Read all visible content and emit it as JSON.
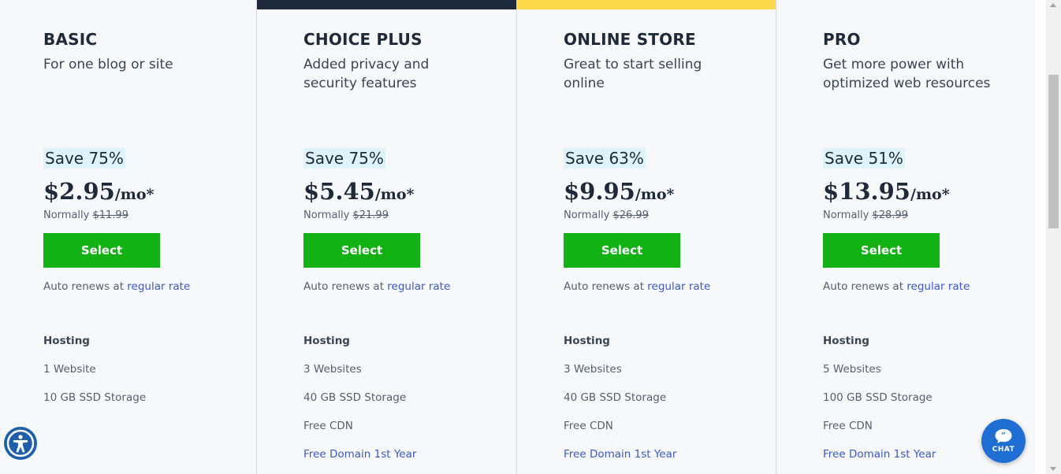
{
  "colors": {
    "choice_plus_topbar": "#1e2a3b",
    "online_store_topbar": "#fcd94a",
    "select_button": "#12b114",
    "link": "#3a59c7",
    "save_badge_bg": "#def3fa"
  },
  "plans": [
    {
      "name": "BASIC",
      "description": "For one blog or site",
      "save": "Save 75%",
      "price": "$2.95",
      "per": "/mo*",
      "normally_label": "Normally",
      "normal_price": "$11.99",
      "select_label": "Select",
      "renew_text": "Auto renews at",
      "renew_link": "regular rate",
      "features_heading": "Hosting",
      "features": [
        "1 Website",
        "10 GB SSD Storage"
      ]
    },
    {
      "name": "CHOICE PLUS",
      "description": "Added privacy and security features",
      "save": "Save 75%",
      "price": "$5.45",
      "per": "/mo*",
      "normally_label": "Normally",
      "normal_price": "$21.99",
      "select_label": "Select",
      "renew_text": "Auto renews at",
      "renew_link": "regular rate",
      "features_heading": "Hosting",
      "features": [
        "3 Websites",
        "40 GB SSD Storage",
        "Free CDN",
        "Free Domain 1st Year"
      ]
    },
    {
      "name": "ONLINE STORE",
      "description": "Great to start selling online",
      "save": "Save 63%",
      "price": "$9.95",
      "per": "/mo*",
      "normally_label": "Normally",
      "normal_price": "$26.99",
      "select_label": "Select",
      "renew_text": "Auto renews at",
      "renew_link": "regular rate",
      "features_heading": "Hosting",
      "features": [
        "3 Websites",
        "40 GB SSD Storage",
        "Free CDN",
        "Free Domain 1st Year"
      ]
    },
    {
      "name": "PRO",
      "description": "Get more power with optimized web resources",
      "save": "Save 51%",
      "price": "$13.95",
      "per": "/mo*",
      "normally_label": "Normally",
      "normal_price": "$28.99",
      "select_label": "Select",
      "renew_text": "Auto renews at",
      "renew_link": "regular rate",
      "features_heading": "Hosting",
      "features": [
        "5 Websites",
        "100 GB SSD Storage",
        "Free CDN",
        "Free Domain 1st Year"
      ]
    }
  ],
  "widgets": {
    "chat_label": "CHAT",
    "accessibility_icon": "accessibility-icon",
    "chat_icon": "chat-bubble-icon"
  }
}
